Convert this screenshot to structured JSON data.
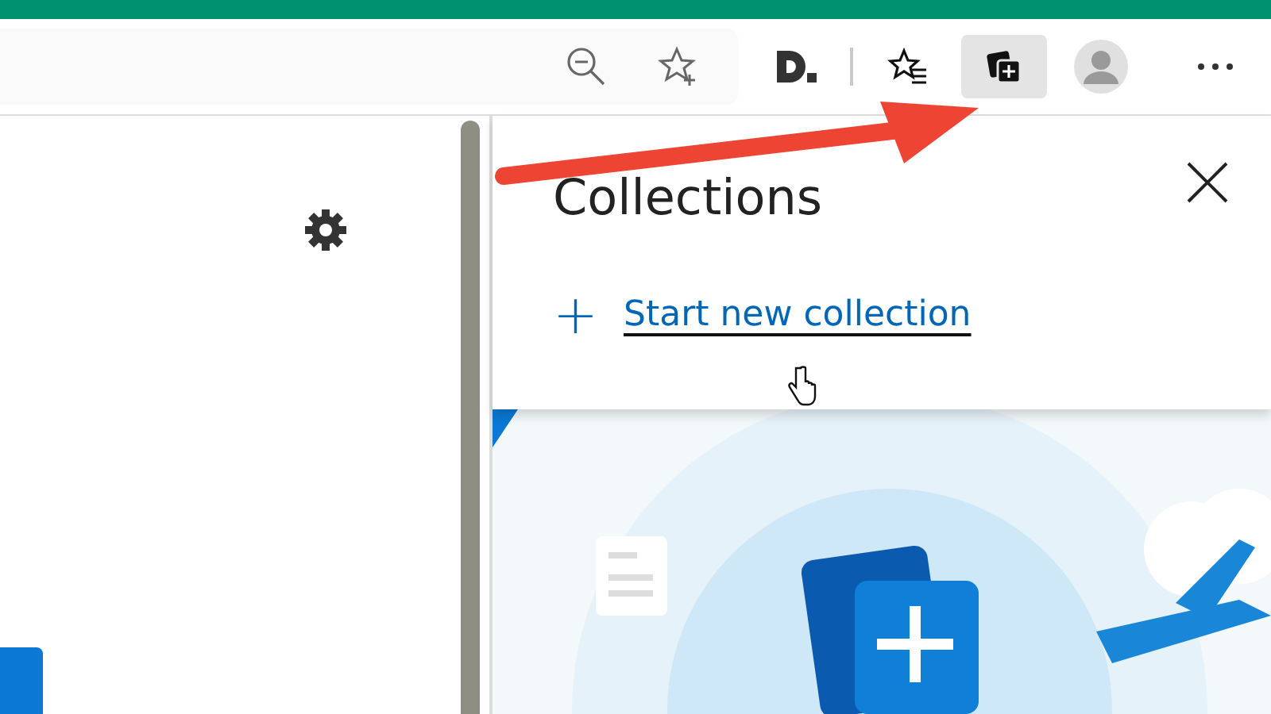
{
  "toolbar": {
    "buttons": [
      {
        "kind": "zoom-out",
        "selected": false
      },
      {
        "kind": "add-favorite",
        "selected": false
      },
      {
        "kind": "extension",
        "selected": false
      },
      {
        "kind": "favorites",
        "selected": false
      },
      {
        "kind": "collections",
        "selected": true
      },
      {
        "kind": "profile",
        "selected": false
      },
      {
        "kind": "more",
        "selected": false
      }
    ]
  },
  "collections_panel": {
    "title": "Collections",
    "action": {
      "icon": "+",
      "label": "Start new collection"
    }
  }
}
